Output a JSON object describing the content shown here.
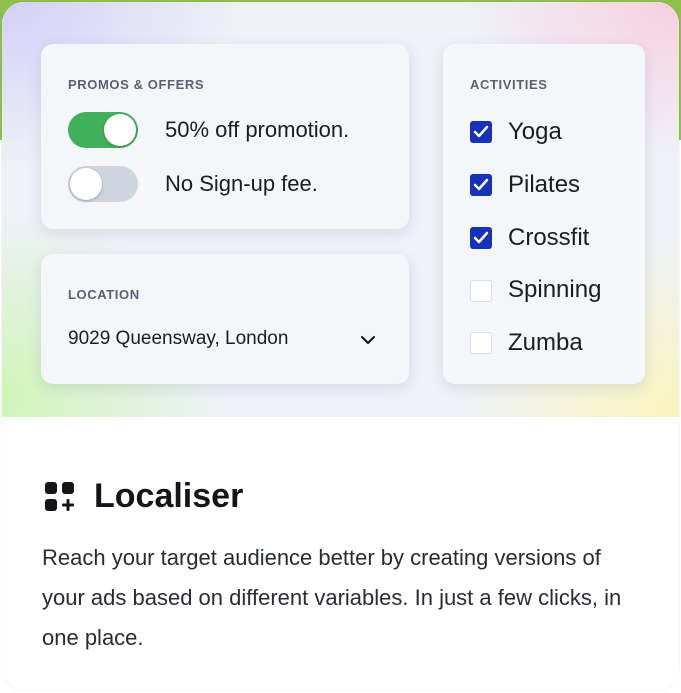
{
  "promos": {
    "heading": "PROMOS & OFFERS",
    "options": [
      {
        "label": "50% off promotion.",
        "state": "on"
      },
      {
        "label": "No Sign-up fee.",
        "state": "off"
      }
    ]
  },
  "location": {
    "heading": "LOCATION",
    "value": "9029 Queensway, London"
  },
  "activities": {
    "heading": "ACTIVITIES",
    "items": [
      {
        "label": "Yoga",
        "checked": true
      },
      {
        "label": "Pilates",
        "checked": true
      },
      {
        "label": "Crossfit",
        "checked": true
      },
      {
        "label": "Spinning",
        "checked": false
      },
      {
        "label": "Zumba",
        "checked": false
      }
    ]
  },
  "feature": {
    "icon": "apps-plus-icon",
    "title": "Localiser",
    "description": "Reach your target audience better by creating versions of your ads based on different variables. In just a few clicks, in one place."
  },
  "colors": {
    "toggle_on": "#43b05c",
    "toggle_off": "#cfd5df",
    "checkbox_checked": "#1632b8",
    "outer_background": "#8fc14a"
  }
}
